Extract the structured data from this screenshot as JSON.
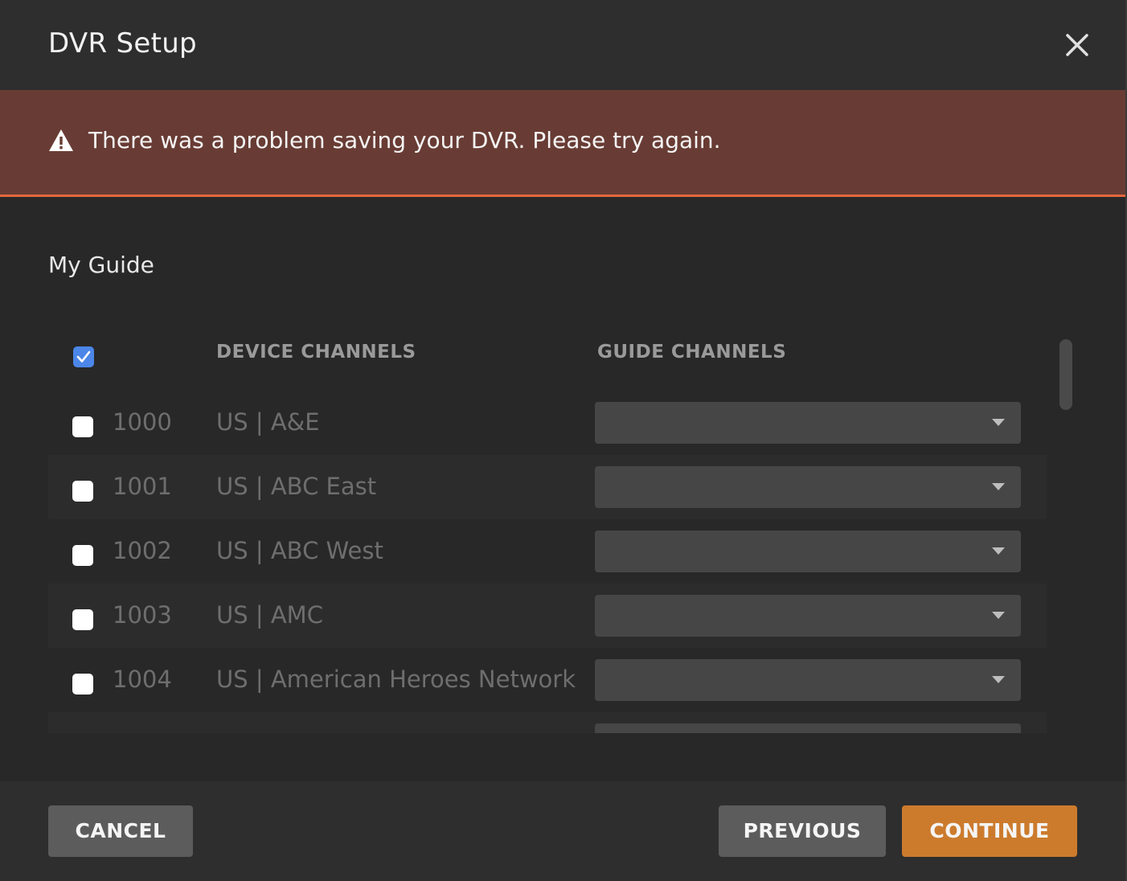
{
  "dialog": {
    "title": "DVR Setup",
    "close_icon": "close-icon"
  },
  "alert": {
    "icon": "warning-icon",
    "message": "There was a problem saving your DVR. Please try again.",
    "accent": "#e5673d"
  },
  "guide": {
    "title": "My Guide",
    "select_all_checked": true,
    "columns": {
      "device": "DEVICE CHANNELS",
      "guide": "GUIDE CHANNELS"
    },
    "rows": [
      {
        "number": "1000",
        "name": "US | A&E",
        "checked": false,
        "guide_value": ""
      },
      {
        "number": "1001",
        "name": "US | ABC East",
        "checked": false,
        "guide_value": ""
      },
      {
        "number": "1002",
        "name": "US | ABC West",
        "checked": false,
        "guide_value": ""
      },
      {
        "number": "1003",
        "name": "US | AMC",
        "checked": false,
        "guide_value": ""
      },
      {
        "number": "1004",
        "name": "US | American Heroes Network",
        "checked": false,
        "guide_value": ""
      },
      {
        "number": "",
        "name": "",
        "checked": false,
        "guide_value": ""
      }
    ]
  },
  "footer": {
    "cancel": "CANCEL",
    "previous": "PREVIOUS",
    "continue": "CONTINUE"
  },
  "colors": {
    "primary_button": "#cc7b2d",
    "checkbox_checked": "#4b86e8",
    "alert_background": "#683c34"
  }
}
